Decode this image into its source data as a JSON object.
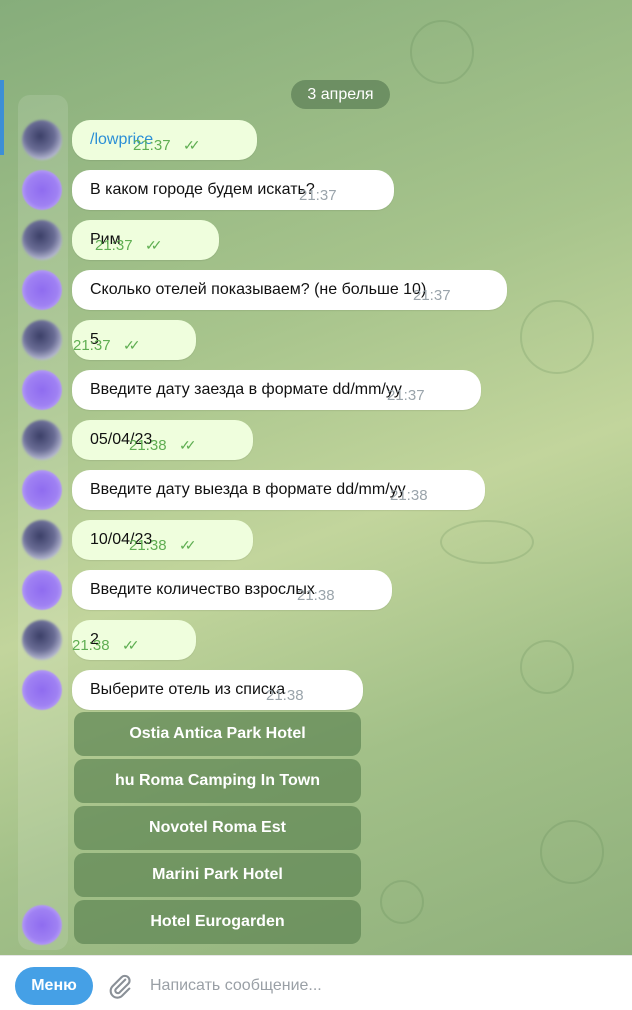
{
  "chat": {
    "date_label": "3 апреля",
    "messages": [
      {
        "dir": "out",
        "text": "/lowprice",
        "time": "21:37",
        "read": true
      },
      {
        "dir": "in",
        "text": "В каком городе будем искать?",
        "time": "21:37"
      },
      {
        "dir": "out",
        "text": "Рим",
        "time": "21:37",
        "read": true
      },
      {
        "dir": "in",
        "text": "Сколько отелей показываем? (не больше 10)",
        "time": "21:37"
      },
      {
        "dir": "out",
        "text": "5",
        "time": "21:37",
        "read": true
      },
      {
        "dir": "in",
        "text": "Введите дату заезда в формате dd/mm/yy",
        "time": "21:37"
      },
      {
        "dir": "out",
        "text": "05/04/23",
        "time": "21:38",
        "read": true
      },
      {
        "dir": "in",
        "text": "Введите дату выезда в формате dd/mm/yy",
        "time": "21:38"
      },
      {
        "dir": "out",
        "text": "10/04/23",
        "time": "21:38",
        "read": true
      },
      {
        "dir": "in",
        "text": "Введите количество взрослых",
        "time": "21:38"
      },
      {
        "dir": "out",
        "text": "2",
        "time": "21:38",
        "read": true
      },
      {
        "dir": "in",
        "text": "Выберите отель из списка",
        "time": "21:38"
      }
    ],
    "hotel_buttons": [
      "Ostia Antica Park Hotel",
      "hu Roma Camping In Town",
      "Novotel Roma Est",
      "Marini Park Hotel",
      "Hotel Eurogarden"
    ],
    "read_mark": "✓✓"
  },
  "composer": {
    "menu_label": "Меню",
    "placeholder": "Написать сообщение...",
    "attach_icon": "paperclip-icon"
  },
  "colors": {
    "outgoing_bubble": "#effedd",
    "incoming_bubble": "#ffffff",
    "accent": "#45a0e6",
    "time_read": "#5fae52"
  }
}
